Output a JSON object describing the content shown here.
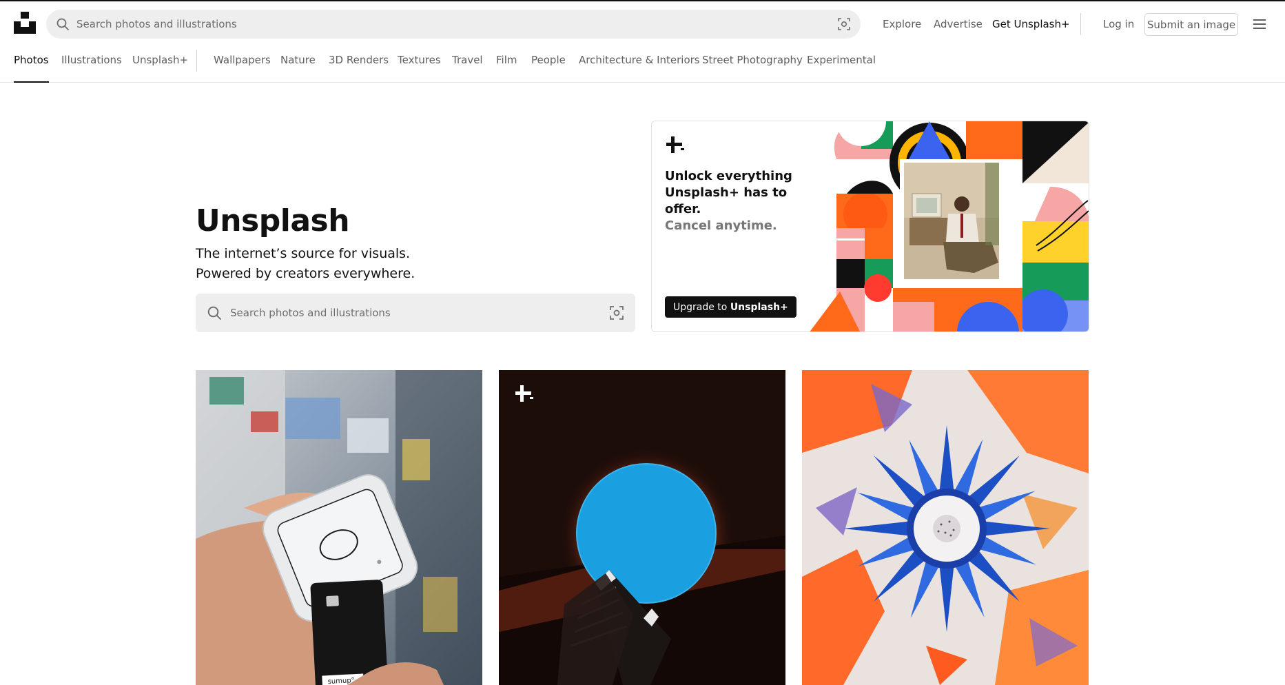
{
  "header": {
    "search_placeholder": "Search photos and illustrations",
    "nav": {
      "explore": "Explore",
      "advertise": "Advertise",
      "get_plus": "Get Unsplash+",
      "login": "Log in",
      "submit": "Submit an image"
    }
  },
  "categories": {
    "primary": [
      "Photos",
      "Illustrations",
      "Unsplash+"
    ],
    "topics": [
      "Wallpapers",
      "Nature",
      "3D Renders",
      "Textures",
      "Travel",
      "Film",
      "People",
      "Architecture & Interiors",
      "Street Photography",
      "Experimental"
    ],
    "active": "Photos"
  },
  "hero": {
    "title": "Unsplash",
    "subtitle_line1": "The internet’s source for visuals.",
    "subtitle_line2": "Powered by creators everywhere.",
    "search_placeholder": "Search photos and illustrations"
  },
  "promo": {
    "headline": "Unlock everything Unsplash+ has to offer.",
    "tagline": "Cancel anytime.",
    "button_prefix": "Upgrade to ",
    "button_brand": "Unsplash+"
  },
  "photos": {
    "card_label": "sumup°"
  },
  "icons": {
    "logo": "unsplash-logo-icon",
    "search": "search-icon",
    "visual_search": "visual-search-icon",
    "menu": "hamburger-menu-icon",
    "plus": "unsplash-plus-icon"
  },
  "colors": {
    "text_primary": "#111111",
    "text_secondary": "#5f5f5f",
    "search_bg": "#eeeeee",
    "border": "#d1d1d1"
  }
}
